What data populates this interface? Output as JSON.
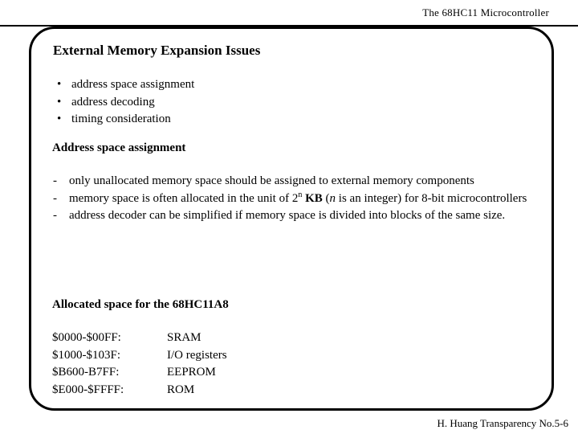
{
  "header": {
    "title": "The 68HC11 Microcontroller"
  },
  "slide": {
    "title": "External Memory Expansion Issues",
    "bullets": [
      {
        "marker": "•",
        "text": "address space assignment"
      },
      {
        "marker": "•",
        "text": "address decoding"
      },
      {
        "marker": "•",
        "text": "timing consideration"
      }
    ],
    "subheading_1": "Address space assignment",
    "dash_items": [
      {
        "marker": "-",
        "text": "only unallocated memory space should be assigned to external memory components"
      },
      {
        "marker": "-",
        "text_before": "memory space is often allocated in the unit of 2",
        "superscript": "n",
        "text_bold": " KB",
        "text_paren_open": " (",
        "italic": "n",
        "text_after": " is an integer) for 8-bit microcontrollers"
      },
      {
        "marker": "-",
        "text": "address decoder can be simplified if memory space is divided into blocks of the same size."
      }
    ],
    "subheading_2": "Allocated space for the 68HC11A8",
    "memory_map": [
      {
        "range": "$0000-$00FF:",
        "device": "SRAM"
      },
      {
        "range": "$1000-$103F:",
        "device": "I/O registers"
      },
      {
        "range": "$B600-B7FF:",
        "device": "EEPROM"
      },
      {
        "range": "$E000-$FFFF:",
        "device": "ROM"
      }
    ]
  },
  "footer": {
    "text": "H. Huang Transparency No.5-6"
  },
  "colors": {
    "ink": "#000000",
    "page": "#ffffff"
  }
}
